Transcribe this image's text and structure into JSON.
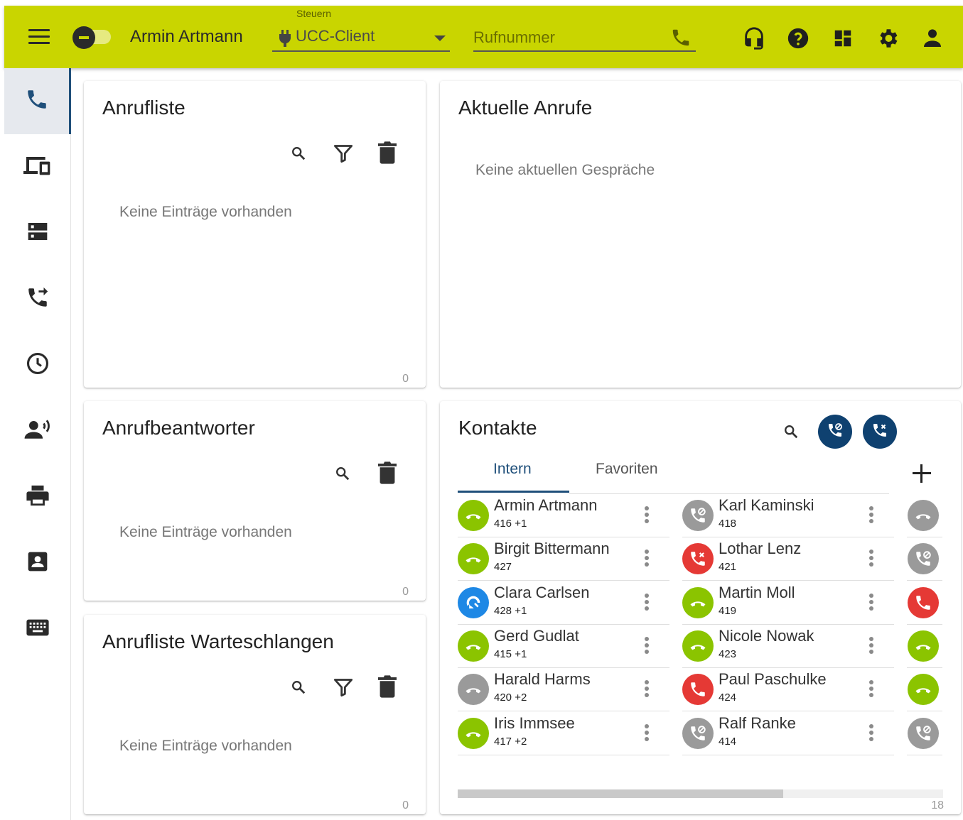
{
  "topbar": {
    "user_name": "Armin Artmann",
    "control_label": "Steuern",
    "control_value": "UCC-Client",
    "phone_placeholder": "Rufnummer",
    "bg_color": "#c9d500",
    "icons": [
      "headset-icon",
      "help-icon",
      "dashboard-icon",
      "settings-icon",
      "account-icon"
    ]
  },
  "sidebar": {
    "items": [
      "phone-icon",
      "devices-icon",
      "server-icon",
      "call-forward-icon",
      "clock-icon",
      "voicemail-icon",
      "printer-icon",
      "contact-card-icon",
      "keyboard-icon"
    ],
    "active_index": 0
  },
  "anrufliste": {
    "title": "Anrufliste",
    "empty": "Keine Einträge vorhanden",
    "count": "0"
  },
  "aktuelle": {
    "title": "Aktuelle Anrufe",
    "empty": "Keine aktuellen Gespräche"
  },
  "anrufbeantworter": {
    "title": "Anrufbeantworter",
    "empty": "Keine Einträge vorhanden",
    "count": "0"
  },
  "warteschlangen": {
    "title": "Anrufliste Warteschlangen",
    "empty": "Keine Einträge vorhanden",
    "count": "0"
  },
  "kontakte": {
    "title": "Kontakte",
    "tabs": [
      "Intern",
      "Favoriten"
    ],
    "active_tab": 0,
    "count": "18",
    "scroll_fraction": 0.67,
    "column1": [
      {
        "name": "Armin Artmann",
        "number": "416 +1",
        "status": "available"
      },
      {
        "name": "Birgit Bittermann",
        "number": "427",
        "status": "available"
      },
      {
        "name": "Clara Carlsen",
        "number": "428 +1",
        "status": "callback"
      },
      {
        "name": "Gerd Gudlat",
        "number": "415 +1",
        "status": "available"
      },
      {
        "name": "Harald Harms",
        "number": "420 +2",
        "status": "offline"
      },
      {
        "name": "Iris Immsee",
        "number": "417 +2",
        "status": "available"
      }
    ],
    "column2": [
      {
        "name": "Karl Kaminski",
        "number": "418",
        "status": "dnd-offline"
      },
      {
        "name": "Lothar Lenz",
        "number": "421",
        "status": "busy-missed"
      },
      {
        "name": "Martin Moll",
        "number": "419",
        "status": "available"
      },
      {
        "name": "Nicole Nowak",
        "number": "423",
        "status": "available"
      },
      {
        "name": "Paul Paschulke",
        "number": "424",
        "status": "busy"
      },
      {
        "name": "Ralf Ranke",
        "number": "414",
        "status": "dnd-offline"
      }
    ],
    "column3": [
      "offline",
      "dnd-offline",
      "busy",
      "available",
      "available",
      "dnd-offline"
    ],
    "status_colors": {
      "available": "#8bc400",
      "offline": "#9a9a9a",
      "dnd-offline": "#9a9a9a",
      "busy": "#e53935",
      "busy-missed": "#e53935",
      "callback": "#1e88e5"
    },
    "accent": "#0f4170"
  }
}
